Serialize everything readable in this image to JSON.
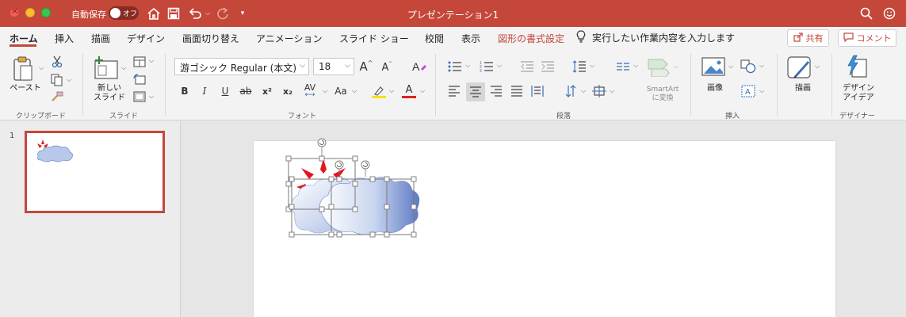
{
  "titlebar": {
    "autosave_label": "自動保存",
    "autosave_state": "オフ",
    "document_title": "プレゼンテーション1"
  },
  "tabs": [
    {
      "label": "ホーム",
      "active": true
    },
    {
      "label": "挿入"
    },
    {
      "label": "描画"
    },
    {
      "label": "デザイン"
    },
    {
      "label": "画面切り替え"
    },
    {
      "label": "アニメーション"
    },
    {
      "label": "スライド ショー"
    },
    {
      "label": "校閲"
    },
    {
      "label": "表示"
    },
    {
      "label": "図形の書式設定"
    }
  ],
  "tell_me": "実行したい作業内容を入力します",
  "share_label": "共有",
  "comment_label": "コメント",
  "ribbon": {
    "paste_label": "ペースト",
    "new_slide_label_1": "新しい",
    "new_slide_label_2": "スライド",
    "font_name": "游ゴシック Regular (本文)",
    "font_size": "18",
    "smartart_label_1": "SmartArt",
    "smartart_label_2": "に変換",
    "image_label": "画像",
    "draw_label": "描画",
    "design_ideas_label_1": "デザイン",
    "design_ideas_label_2": "アイデア",
    "groups": {
      "clipboard": "クリップボード",
      "slides": "スライド",
      "font": "フォント",
      "paragraph": "段落",
      "insert": "挿入",
      "designer": "デザイナー"
    },
    "font_buttons": {
      "bold": "B",
      "italic": "I",
      "underline": "U",
      "strike": "ab",
      "superscript": "x²",
      "subscript": "x₂",
      "spacing": "AV",
      "case": "Aa",
      "grow": "A",
      "shrink": "A"
    }
  },
  "slide_panel": {
    "slide_number": "1"
  },
  "colors": {
    "accent": "#c4473a",
    "highlight_bar": "#f5e31c",
    "font_color_bar": "#d9261c"
  }
}
